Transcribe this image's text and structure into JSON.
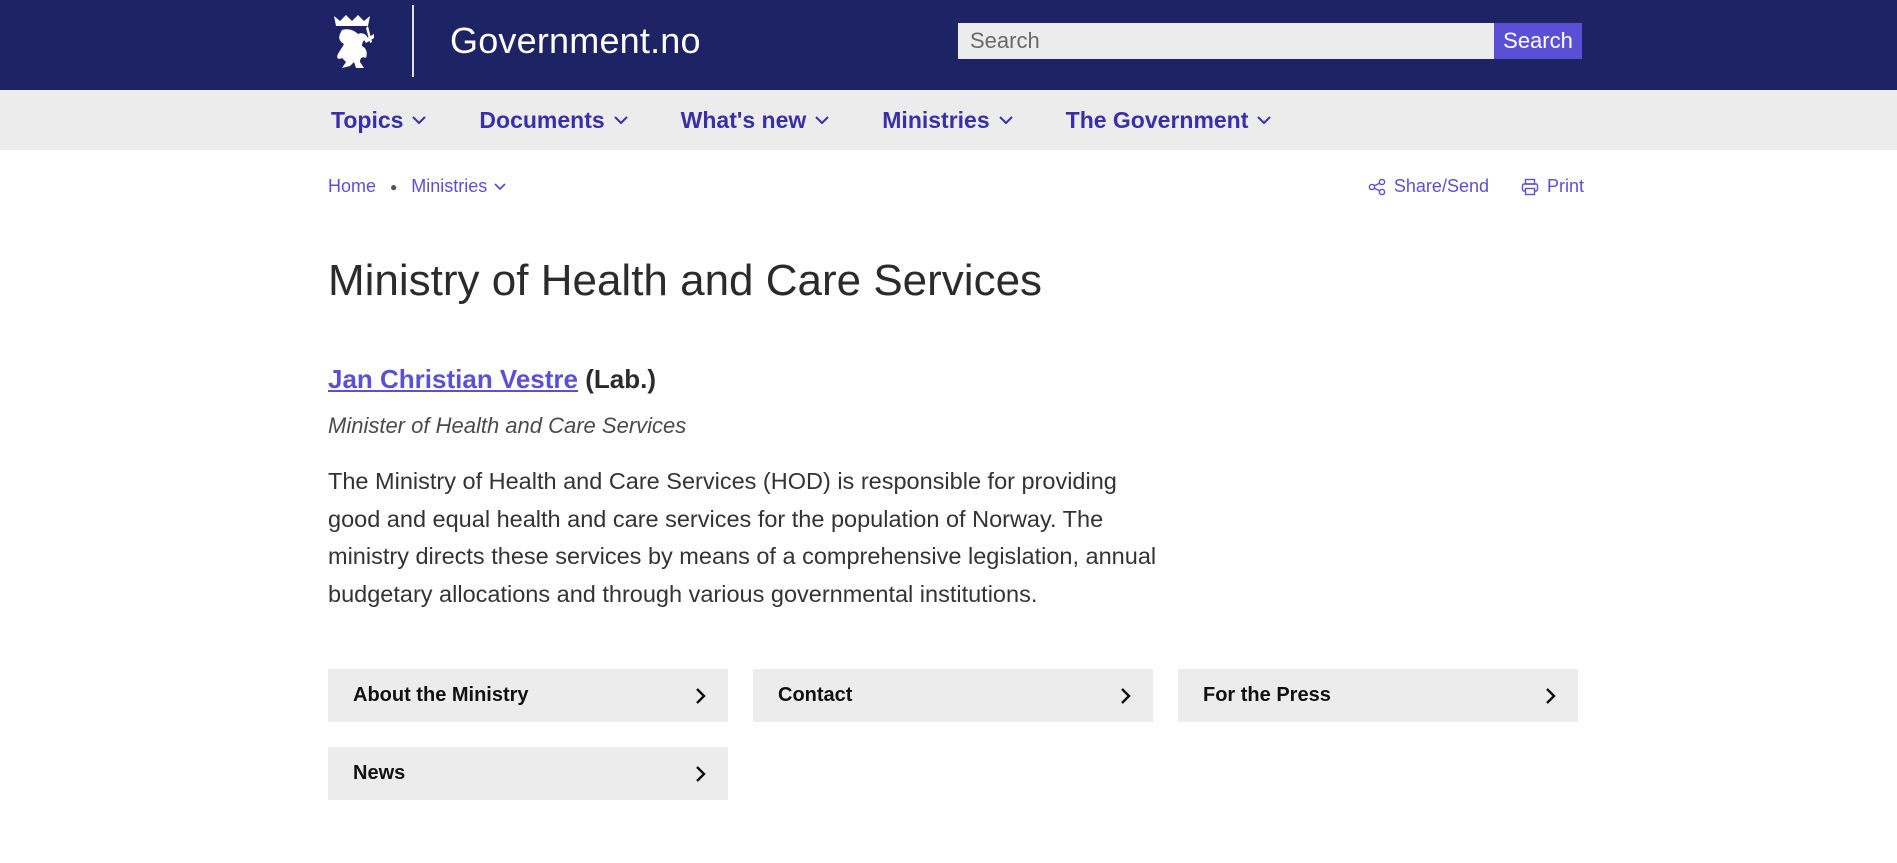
{
  "header": {
    "site_title": "Government.no",
    "search": {
      "placeholder": "Search",
      "value": "",
      "button_label": "Search"
    },
    "colors": {
      "header_bg": "#1d2364",
      "accent": "#5b4fd6"
    }
  },
  "nav": {
    "items": [
      {
        "label": "Topics",
        "icon": "chevron-down-icon"
      },
      {
        "label": "Documents",
        "icon": "chevron-down-icon"
      },
      {
        "label": "What's new",
        "icon": "chevron-down-icon"
      },
      {
        "label": "Ministries",
        "icon": "chevron-down-icon"
      },
      {
        "label": "The Government",
        "icon": "chevron-down-icon"
      }
    ]
  },
  "breadcrumb": {
    "items": [
      {
        "label": "Home"
      },
      {
        "label": "Ministries",
        "icon": "chevron-down-icon"
      }
    ]
  },
  "tools": {
    "share_label": "Share/Send",
    "print_label": "Print"
  },
  "main": {
    "title": "Ministry of Health and Care Services",
    "minister": {
      "name": "Jan Christian Vestre",
      "party": "(Lab.)",
      "role": "Minister of Health and Care Services"
    },
    "intro": "The Ministry of Health and Care Services (HOD) is responsible for providing good and equal health and care services for the population of Norway. The ministry directs these services by means of a comprehensive legislation, annual budgetary allocations and through various governmental institutions.",
    "cards": [
      {
        "label": "About the Ministry"
      },
      {
        "label": "Contact"
      },
      {
        "label": "For the Press"
      },
      {
        "label": "News"
      }
    ]
  }
}
